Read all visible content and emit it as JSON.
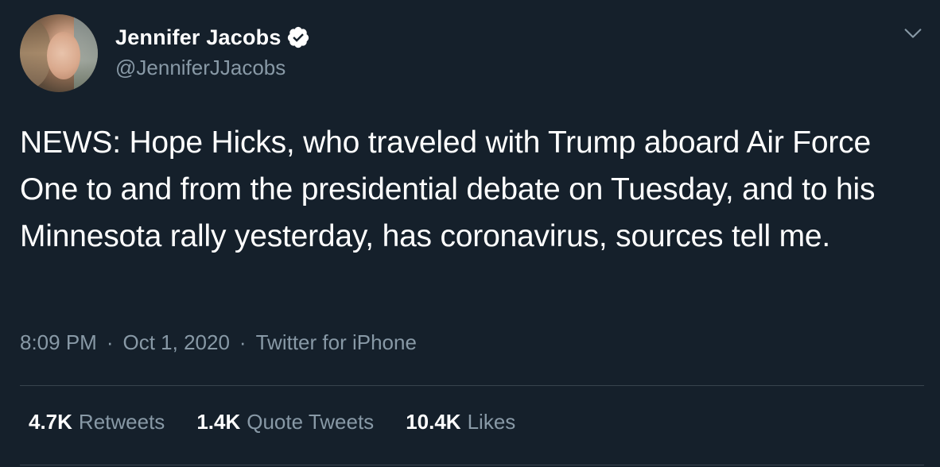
{
  "author": {
    "name": "Jennifer Jacobs",
    "handle": "@JenniferJJacobs",
    "verified": true,
    "avatar_icon": "profile-photo"
  },
  "tweet": {
    "text": "NEWS: Hope Hicks, who traveled with Trump aboard Air Force One to and from the presidential debate on Tuesday, and to his Minnesota rally yesterday, has coronavirus, sources tell me.",
    "time": "8:09 PM",
    "date": "Oct 1, 2020",
    "source": "Twitter for iPhone",
    "separator": "·"
  },
  "stats": {
    "retweets_count": "4.7K",
    "retweets_label": "Retweets",
    "quotes_count": "1.4K",
    "quotes_label": "Quote Tweets",
    "likes_count": "10.4K",
    "likes_label": "Likes"
  },
  "icons": {
    "verified": "verified-badge-icon",
    "menu": "chevron-down-icon"
  },
  "colors": {
    "background": "#15202b",
    "text_primary": "#ffffff",
    "text_secondary": "#8899a6",
    "divider": "#38444d",
    "verified": "#ffffff"
  }
}
